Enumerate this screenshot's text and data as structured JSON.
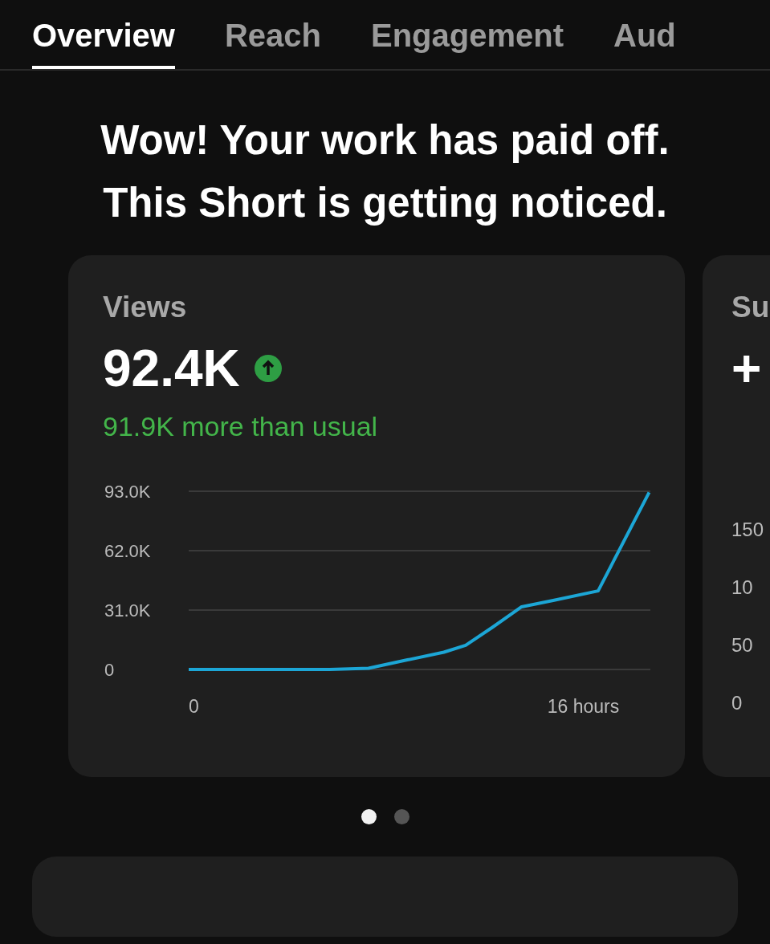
{
  "tabs": [
    {
      "label": "Overview",
      "selected": true
    },
    {
      "label": "Reach",
      "selected": false
    },
    {
      "label": "Engagement",
      "selected": false
    },
    {
      "label": "Aud",
      "selected": false
    }
  ],
  "headline": "Wow! Your work has paid off. This Short is getting noticed.",
  "cards": [
    {
      "title": "Views",
      "value": "92.4K",
      "note": "91.9K more than usual",
      "chart_data": {
        "type": "line",
        "x": [
          0,
          5.8,
          7.4,
          9,
          10.5,
          11.4,
          12.5,
          13.7,
          15,
          16.85,
          18.95
        ],
        "xlim": [
          0,
          19
        ],
        "ylim": [
          0,
          93000
        ],
        "xticks": [
          0,
          {
            "value": 16,
            "label": "16 hours"
          }
        ],
        "yticks": [
          0,
          {
            "value": 31000,
            "label": "31.0K"
          },
          {
            "value": 62000,
            "label": "62.0K"
          },
          {
            "value": 93000,
            "label": "93.0K"
          }
        ],
        "series": [
          {
            "color": "#1ca6d6",
            "values": [
              0,
              0,
              600,
              5000,
              9000,
              12600,
              22000,
              32700,
              36000,
              41000,
              92400
            ]
          }
        ]
      }
    },
    {
      "title": "Su",
      "value": "+",
      "axis_labels": [
        "150",
        "10",
        "50",
        "0"
      ]
    }
  ],
  "pager": [
    {
      "selected": true
    },
    {
      "selected": false
    }
  ]
}
